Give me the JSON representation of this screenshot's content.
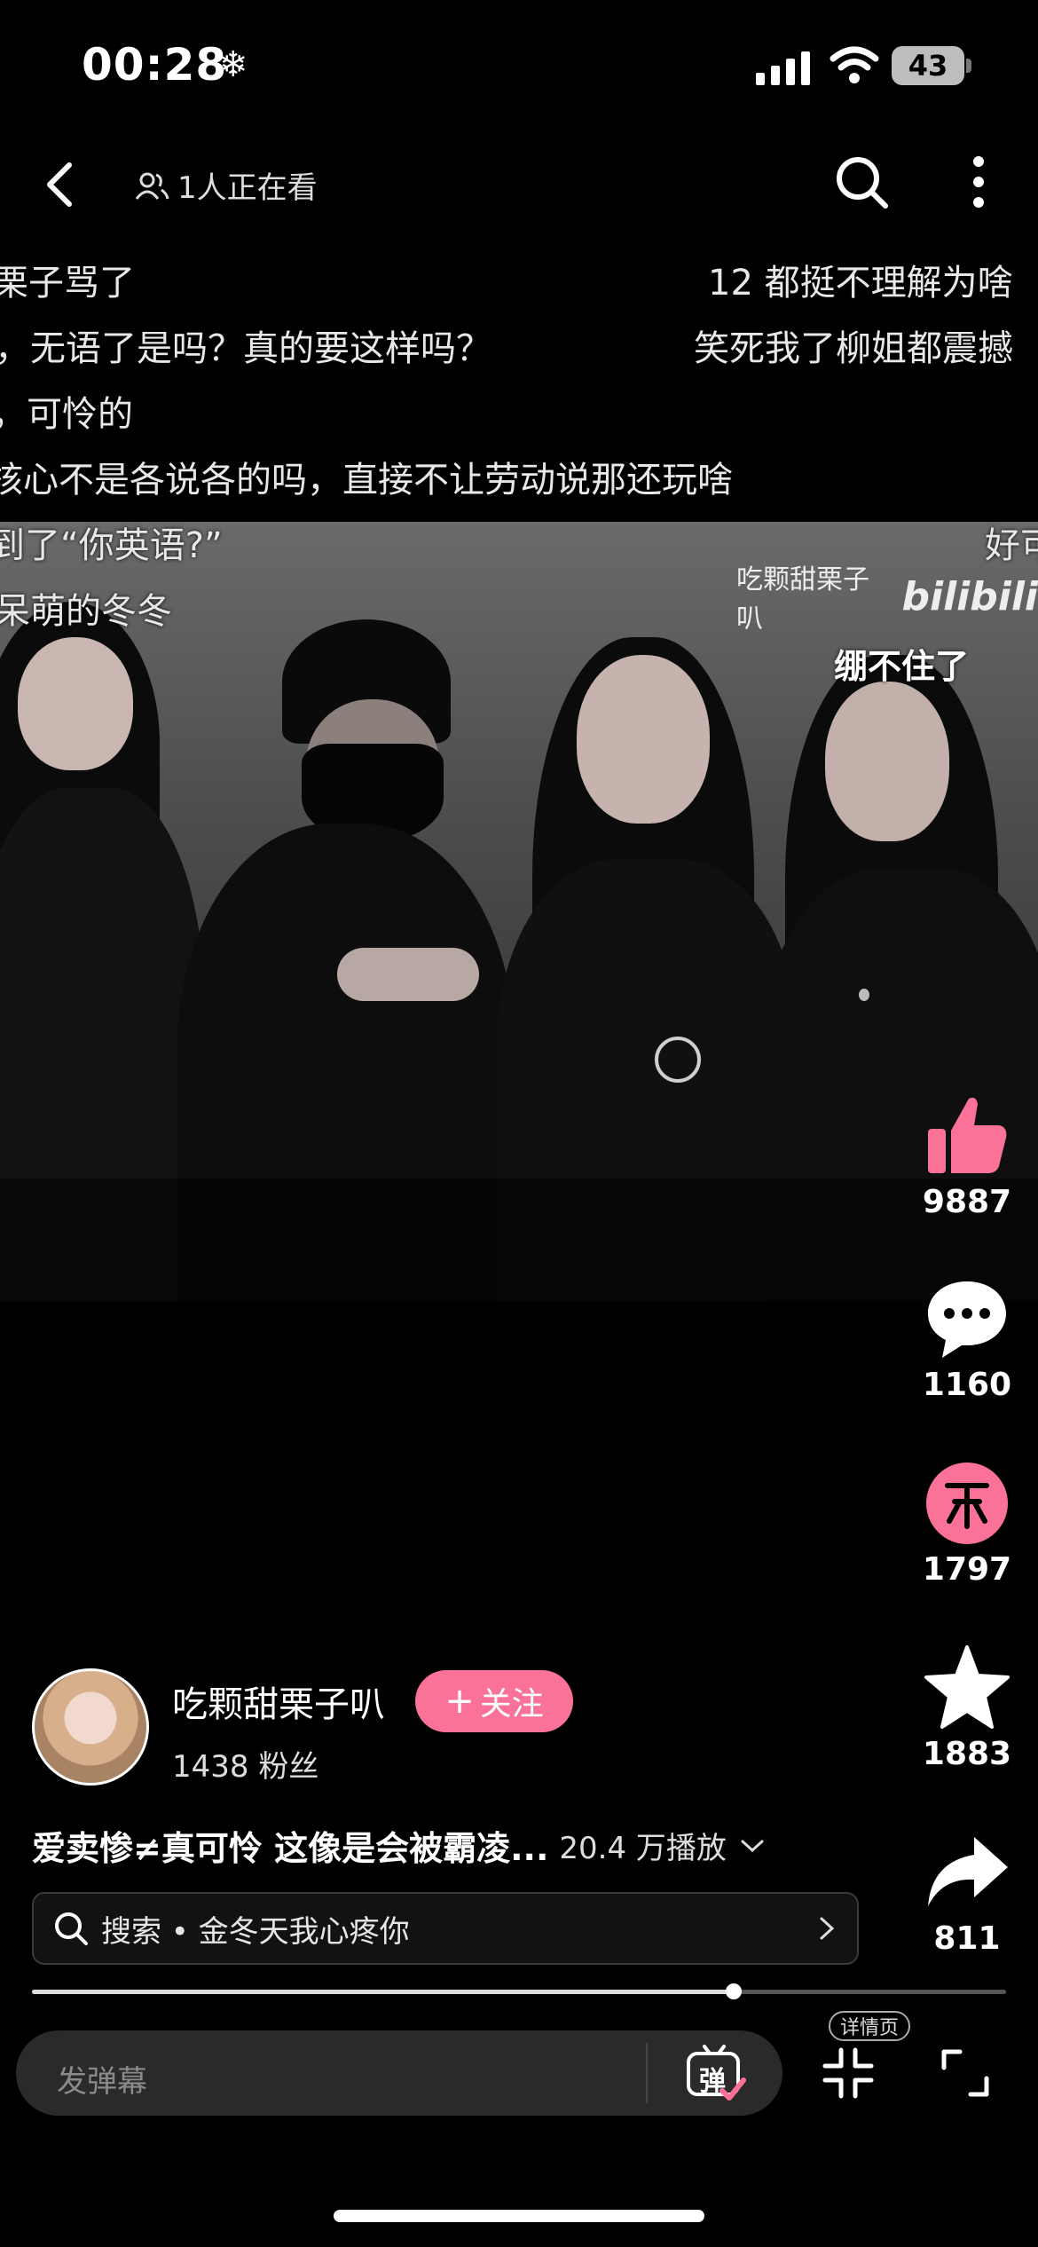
{
  "status_bar": {
    "time": "00:28",
    "battery": "43"
  },
  "header": {
    "viewers_text": "1人正在看"
  },
  "danmaku": [
    "栗子骂了",
    "12 都挺不理解为啥",
    "，无语了是吗？真的要这样吗？",
    "笑死我了柳姐都震撼",
    "，可怜的",
    "核心不是各说各的吗，直接不让劳动说那还玩啥",
    "到了“你英语?”",
    "好可",
    "呆萌的冬冬"
  ],
  "video": {
    "watermark_user": "吃颗甜栗子叭",
    "watermark_brand": "bilibili",
    "caption": "绷不住了"
  },
  "actions": {
    "like_count": "9887",
    "comment_count": "1160",
    "coin_count": "1797",
    "favorite_count": "1883",
    "share_count": "811"
  },
  "uploader": {
    "name": "吃颗甜栗子叭",
    "follow_label": "关注",
    "fans": "1438 粉丝"
  },
  "video_info": {
    "title": "爱卖惨≠真可怜 这像是会被霸凌...",
    "plays": "20.4 万播放"
  },
  "search": {
    "text": "搜索 • 金冬天我心疼你"
  },
  "progress": {
    "fraction": 0.72
  },
  "bottom_bar": {
    "danmu_placeholder": "发弹幕",
    "danmu_toggle": "弹",
    "detail_label": "详情页"
  },
  "colors": {
    "accent": "#fb7299",
    "background": "#000000"
  }
}
